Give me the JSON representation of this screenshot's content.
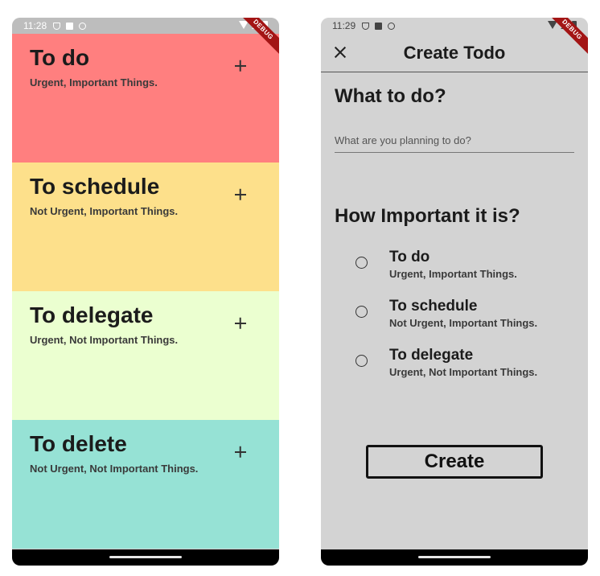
{
  "left": {
    "status": {
      "time": "11:28"
    },
    "debug_label": "DEBUG",
    "quadrants": [
      {
        "title": "To do",
        "subtitle": "Urgent, Important Things.",
        "color": "#ff7f7f"
      },
      {
        "title": "To schedule",
        "subtitle": "Not Urgent, Important Things.",
        "color": "#fde08b"
      },
      {
        "title": "To delegate",
        "subtitle": "Urgent, Not Important Things.",
        "color": "#ebffd0"
      },
      {
        "title": "To delete",
        "subtitle": "Not Urgent, Not Important Things.",
        "color": "#96e2d5"
      }
    ]
  },
  "right": {
    "status": {
      "time": "11:29"
    },
    "debug_label": "DEBUG",
    "appbar": {
      "title": "Create Todo",
      "close_icon": "close-icon"
    },
    "what_heading": "What to do?",
    "input_placeholder": "What are you planning to do?",
    "importance_heading": "How Important it is?",
    "options": [
      {
        "title": "To do",
        "subtitle": "Urgent, Important Things.",
        "selected": false
      },
      {
        "title": "To schedule",
        "subtitle": "Not Urgent, Important Things.",
        "selected": false
      },
      {
        "title": "To delegate",
        "subtitle": "Urgent, Not Important Things.",
        "selected": false
      }
    ],
    "create_label": "Create"
  },
  "colors": {
    "screen_bg": "#d3d3d3",
    "debug_banner": "#a31515",
    "nav_bar": "#000000"
  }
}
